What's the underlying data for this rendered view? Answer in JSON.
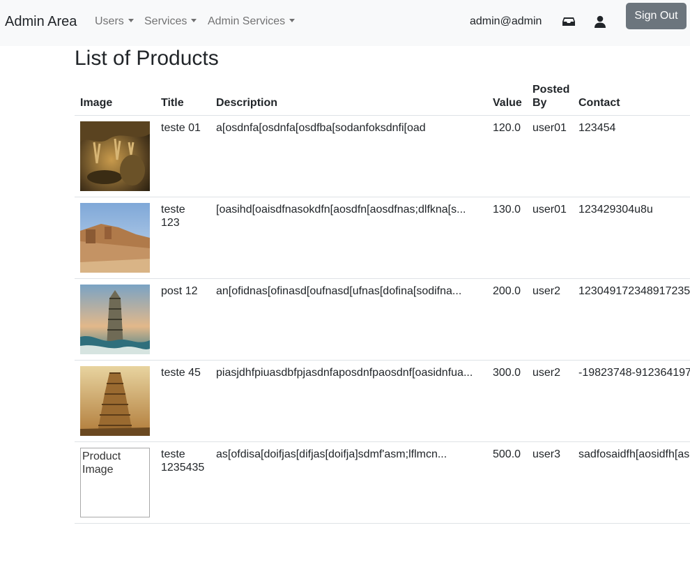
{
  "navbar": {
    "brand": "Admin Area",
    "menus": [
      "Users",
      "Services",
      "Admin Services"
    ],
    "user_email": "admin@admin",
    "icons": [
      "inbox-icon",
      "user-icon"
    ],
    "signout_label": "Sign Out",
    "background": "#f8f9fa",
    "signout_color": "#6c757d"
  },
  "page": {
    "title": "List of Products"
  },
  "table": {
    "headers": {
      "image": "Image",
      "title": "Title",
      "description": "Description",
      "value": "Value",
      "posted_by": "Posted By",
      "contact": "Contact"
    },
    "rows": [
      {
        "image": "cave-photo",
        "title": "teste 01",
        "description": "a[osdnfa[osdnfa[osdfba[sodanfoksdnfi[oad",
        "value": "120.0",
        "posted_by": "user01",
        "contact": "123454"
      },
      {
        "image": "ruins-photo",
        "title": "teste 123",
        "description": "[oasihd[oaisdfnasokdfn[aosdfn[aosdfnas;dlfkna[s...",
        "value": "130.0",
        "posted_by": "user01",
        "contact": "123429304u8u"
      },
      {
        "image": "tower-painting",
        "title": "post 12",
        "description": "an[ofidnas[ofinasd[oufnasd[ufnas[dofina[sodifna...",
        "value": "200.0",
        "posted_by": "user2",
        "contact": "123049172348917235"
      },
      {
        "image": "babel-painting",
        "title": "teste 45",
        "description": "piasjdhfpiuasdbfpjasdnfaposdnfpaosdnf[oasidnfua...",
        "value": "300.0",
        "posted_by": "user2",
        "contact": "-19823748-912364197"
      },
      {
        "image": "broken-image",
        "image_alt": "Product Image",
        "title": "teste 1235435",
        "description": "as[ofdisa[doifjas[difjas[doifja]sdmf'asm;lflmcn...",
        "value": "500.0",
        "posted_by": "user3",
        "contact": "sadfosaidfh[aosidfh[as"
      }
    ]
  }
}
